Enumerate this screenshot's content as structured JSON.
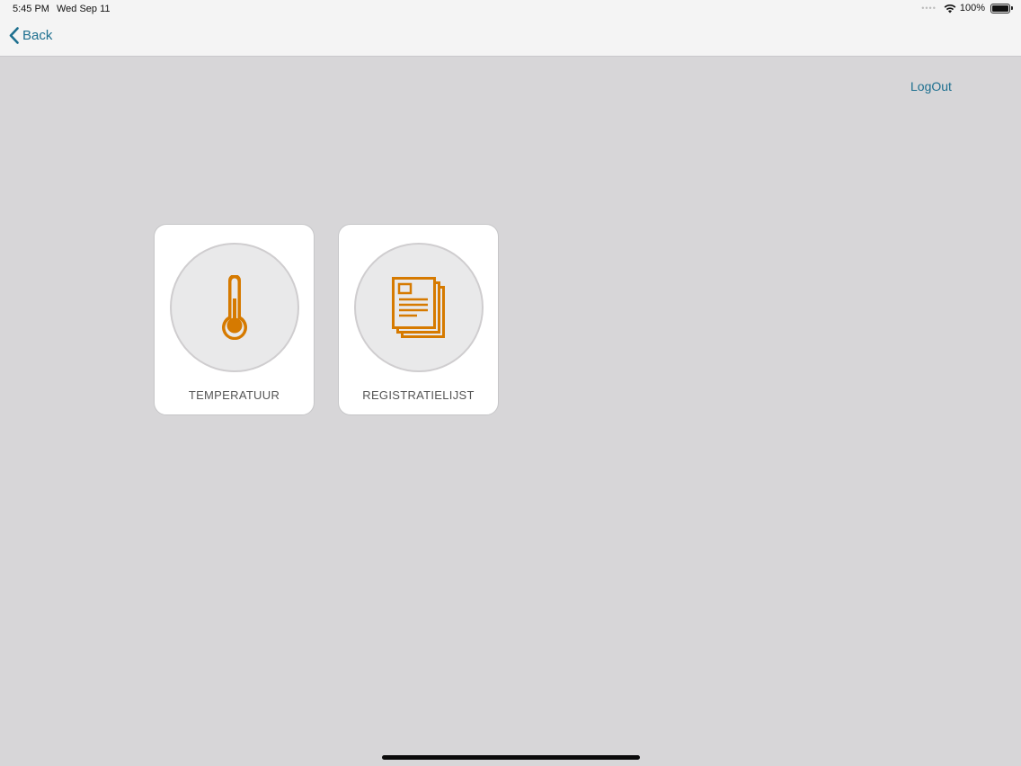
{
  "status_bar": {
    "time": "5:45 PM",
    "date": "Wed Sep 11",
    "battery": "100%",
    "icons": [
      "cellular-icon",
      "wifi-icon",
      "battery-icon"
    ]
  },
  "nav": {
    "back_label": "Back"
  },
  "logout_label": "LogOut",
  "tiles": [
    {
      "label": "TEMPERATUUR",
      "icon": "thermometer-icon"
    },
    {
      "label": "REGISTRATIELIJST",
      "icon": "documents-icon"
    }
  ],
  "colors": {
    "accent": "#1d6f8f",
    "icon": "#d67a00",
    "background": "#d7d6d8"
  }
}
